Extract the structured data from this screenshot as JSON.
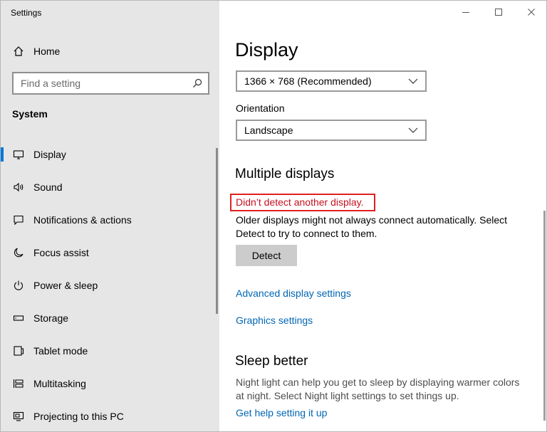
{
  "window": {
    "title": "Settings"
  },
  "sidebar": {
    "home_label": "Home",
    "search_placeholder": "Find a setting",
    "section_title": "System",
    "items": [
      {
        "label": "Display",
        "icon": "monitor-icon",
        "active": true
      },
      {
        "label": "Sound",
        "icon": "speaker-icon"
      },
      {
        "label": "Notifications & actions",
        "icon": "notification-icon"
      },
      {
        "label": "Focus assist",
        "icon": "moon-icon"
      },
      {
        "label": "Power & sleep",
        "icon": "power-icon"
      },
      {
        "label": "Storage",
        "icon": "storage-icon"
      },
      {
        "label": "Tablet mode",
        "icon": "tablet-icon"
      },
      {
        "label": "Multitasking",
        "icon": "multitasking-icon"
      },
      {
        "label": "Projecting to this PC",
        "icon": "projector-icon"
      }
    ]
  },
  "main": {
    "title": "Display",
    "resolution_value": "1366 × 768 (Recommended)",
    "orientation_label": "Orientation",
    "orientation_value": "Landscape",
    "multiple_displays_heading": "Multiple displays",
    "error_text": "Didn’t detect another display.",
    "detect_desc_line1": "Older displays might not always connect automatically. Select",
    "detect_desc_line2": "Detect to try to connect to them.",
    "detect_button": "Detect",
    "advanced_link": "Advanced display settings",
    "graphics_link": "Graphics settings",
    "sleep_heading": "Sleep better",
    "sleep_desc_line1": "Night light can help you get to sleep by displaying warmer colors",
    "sleep_desc_line2": "at night. Select Night light settings to set things up.",
    "help_link": "Get help setting it up"
  },
  "colors": {
    "accent": "#0078d7",
    "link": "#0066b4",
    "error": "#c50f1f",
    "sidebar_bg": "#e6e6e6"
  }
}
